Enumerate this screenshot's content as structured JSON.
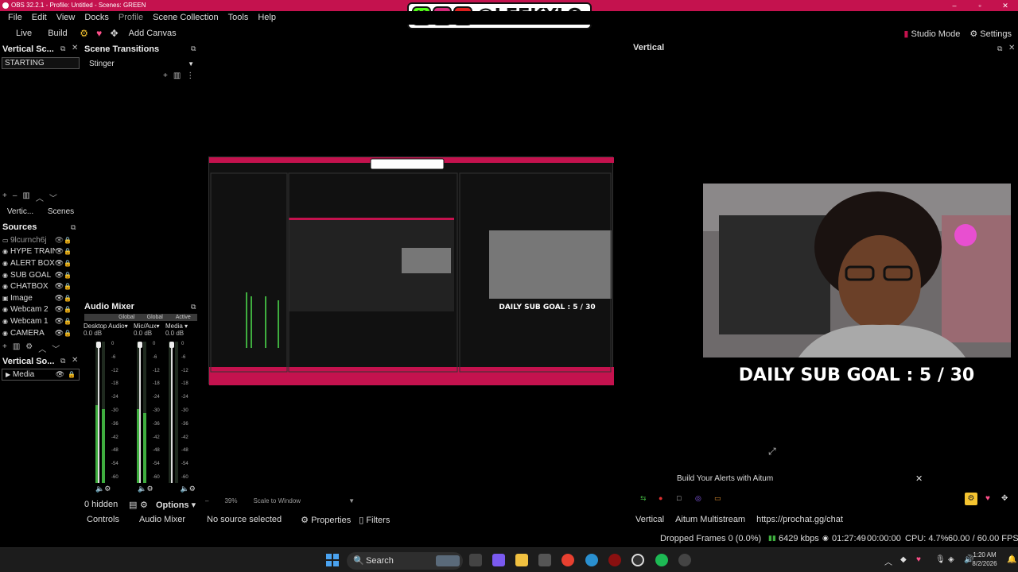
{
  "window": {
    "title": "OBS 32.2.1 - Profile: Untitled - Scenes: GREEN",
    "brand_handle": "@LEEKYLO",
    "controls": [
      "–",
      "▫",
      "✕"
    ]
  },
  "menu": [
    "File",
    "Edit",
    "View",
    "Docks",
    "Profile",
    "Scene Collection",
    "Tools",
    "Help"
  ],
  "toolbar": {
    "live": "Live",
    "build": "Build",
    "add_canvas": "Add Canvas",
    "studio_mode": "Studio Mode",
    "settings": "Settings"
  },
  "vertical_scenes": {
    "title": "Vertical Sc...",
    "selected": "STARTING",
    "tabs": [
      "Vertic...",
      "Scenes"
    ]
  },
  "scene_transitions": {
    "title": "Scene Transitions",
    "selected": "Stinger"
  },
  "sources": {
    "title": "Sources",
    "items": [
      {
        "label": "9lcurnch6j",
        "dim": true
      },
      {
        "label": "HYPE TRAIN"
      },
      {
        "label": "ALERT BOX"
      },
      {
        "label": "SUB GOAL"
      },
      {
        "label": "CHATBOX"
      },
      {
        "label": "Image"
      },
      {
        "label": "Webcam 2"
      },
      {
        "label": "Webcam 1"
      },
      {
        "label": "CAMERA"
      }
    ]
  },
  "vertical_sources": {
    "title": "Vertical So...",
    "item": "Media"
  },
  "audio_mixer": {
    "title": "Audio Mixer",
    "headers": [
      "",
      "Global",
      "Global",
      "Active"
    ],
    "channels": [
      {
        "name": "Desktop Audio",
        "db": "0.0 dB",
        "level": 0.55
      },
      {
        "name": "Mic/Aux",
        "db": "0.0 dB",
        "level": 0.52
      },
      {
        "name": "Media",
        "db": "0.0 dB",
        "level": 0.0
      }
    ],
    "scale": [
      "0",
      "-6",
      "-12",
      "-18",
      "-24",
      "-30",
      "-36",
      "-42",
      "-48",
      "-54",
      "-60"
    ],
    "hidden": "0 hidden",
    "options": "Options"
  },
  "preview": {
    "zoom": "39%",
    "scale_mode": "Scale to Window"
  },
  "vertical_canvas": {
    "title": "Vertical",
    "goal": "DAILY SUB GOAL : 5 / 30",
    "aitum_banner": "Build Your Alerts with Aitum",
    "close": "✕"
  },
  "bottom_tabs": {
    "left": [
      "Controls",
      "Audio Mixer"
    ],
    "no_source": "No source selected",
    "properties": "Properties",
    "filters": "Filters",
    "right": [
      "Vertical",
      "Aitum Multistream",
      "https://prochat.gg/chat"
    ]
  },
  "status": {
    "dropped": "Dropped Frames 0 (0.0%)",
    "kbps": "6429 kbps",
    "stream_time": "01:27:49",
    "rec_time": "00:00:00",
    "cpu": "CPU: 4.7%",
    "fps": "60.00 / 60.00 FPS"
  },
  "taskbar": {
    "search": "Search",
    "time": "1:20 AM",
    "date": "8/2/2026"
  },
  "colors": {
    "accent": "#c4124e",
    "meter_green": "#3fae3f",
    "meter_yellow": "#c8b23a",
    "meter_red": "#c03a3a"
  }
}
